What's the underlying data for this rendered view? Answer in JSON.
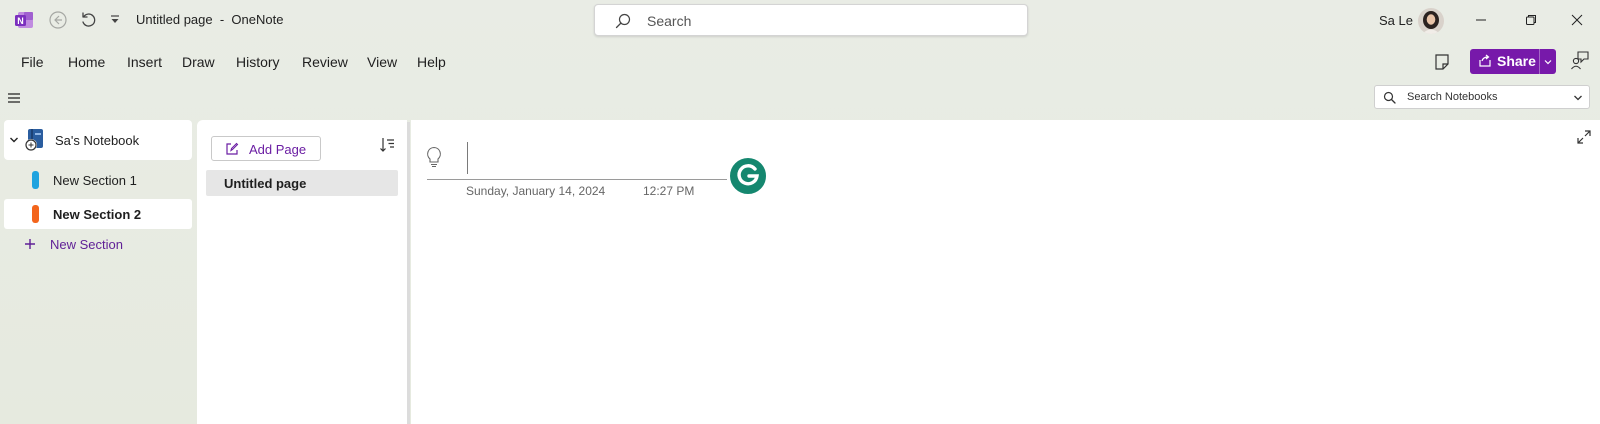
{
  "titlebar": {
    "doc_title": "Untitled page  -  OneNote",
    "search_placeholder": "Search",
    "user_name": "Sa Le"
  },
  "ribbon": {
    "tabs": [
      "File",
      "Home",
      "Insert",
      "Draw",
      "History",
      "Review",
      "View",
      "Help"
    ],
    "share_label": "Share"
  },
  "notebook_search": {
    "placeholder": "Search Notebooks"
  },
  "notebook": {
    "name": "Sa's Notebook",
    "sections": [
      {
        "label": "New Section 1",
        "color": "#1fa3df"
      },
      {
        "label": "New Section 2",
        "color": "#f3651c"
      }
    ],
    "add_section_label": "New Section"
  },
  "pages": {
    "add_page_label": "Add Page",
    "items": [
      {
        "label": "Untitled page"
      }
    ]
  },
  "page": {
    "date": "Sunday, January 14, 2024",
    "time": "12:27 PM"
  },
  "colors": {
    "brand_purple": "#7719aa",
    "onenote_logo": "#7b2fbe",
    "grammarly_green": "#15876f"
  },
  "icons": [
    "onenote-logo-icon",
    "back-icon",
    "undo-icon",
    "customize-qat-icon",
    "search-icon",
    "avatar",
    "minimize-icon",
    "maximize-icon",
    "close-icon",
    "sticky-notes-icon",
    "share-icon",
    "chevron-down-icon",
    "feedback-icon",
    "hamburger-icon",
    "notebook-icon",
    "plus-icon",
    "add-page-icon",
    "sort-icon",
    "expand-icon",
    "lightbulb-icon",
    "grammarly-icon"
  ]
}
